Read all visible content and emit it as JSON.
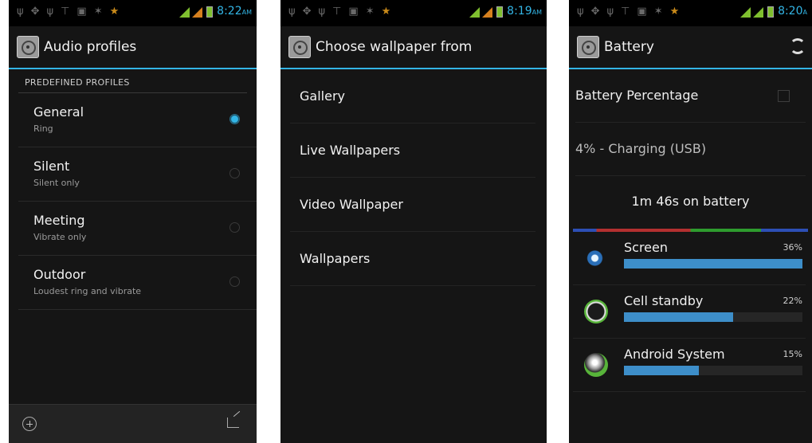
{
  "accent_color": "#33b5e5",
  "panel1": {
    "status": {
      "time": "8:22",
      "ampm": "AM"
    },
    "title": "Audio profiles",
    "section_header": "PREDEFINED PROFILES",
    "profiles": [
      {
        "title": "General",
        "subtitle": "Ring",
        "selected": true
      },
      {
        "title": "Silent",
        "subtitle": "Silent only",
        "selected": false
      },
      {
        "title": "Meeting",
        "subtitle": "Vibrate only",
        "selected": false
      },
      {
        "title": "Outdoor",
        "subtitle": "Loudest ring and vibrate",
        "selected": false
      }
    ],
    "bottom_icons": [
      "add-icon",
      "share-icon"
    ]
  },
  "panel2": {
    "status": {
      "time": "8:19",
      "ampm": "AM"
    },
    "title": "Choose wallpaper from",
    "items": [
      "Gallery",
      "Live Wallpapers",
      "Video Wallpaper",
      "Wallpapers"
    ]
  },
  "panel3": {
    "status": {
      "time": "8:20",
      "ampm": "A"
    },
    "title": "Battery",
    "battery_percentage_label": "Battery Percentage",
    "battery_percentage_checked": false,
    "charge_status": "4% - Charging (USB)",
    "on_battery": "1m 46s on battery",
    "usage": [
      {
        "name": "Screen",
        "percent_label": "36%",
        "bar_fraction": 1.0,
        "icon": "screen-icon"
      },
      {
        "name": "Cell standby",
        "percent_label": "22%",
        "bar_fraction": 0.61,
        "icon": "cell-standby-icon"
      },
      {
        "name": "Android System",
        "percent_label": "15%",
        "bar_fraction": 0.42,
        "icon": "android-system-icon"
      }
    ]
  }
}
